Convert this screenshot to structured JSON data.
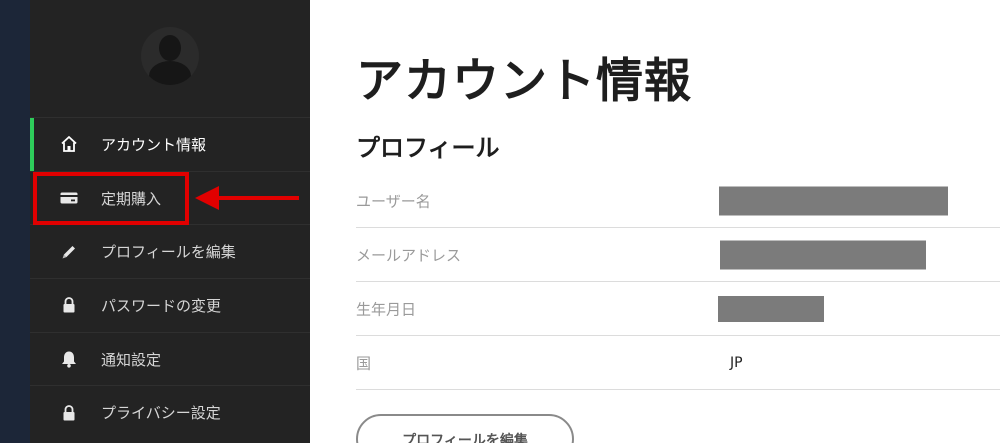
{
  "colors": {
    "sidebar_bg": "#232323",
    "left_strip": "#1c2638",
    "active_accent": "#2ecc5a",
    "highlight": "#e10000",
    "redaction": "#7b7b7b"
  },
  "sidebar": {
    "items": [
      {
        "label": "アカウント情報",
        "icon": "home-icon",
        "active": true
      },
      {
        "label": "定期購入",
        "icon": "credit-card-icon",
        "active": false
      },
      {
        "label": "プロフィールを編集",
        "icon": "pencil-icon",
        "active": false
      },
      {
        "label": "パスワードの変更",
        "icon": "lock-icon",
        "active": false
      },
      {
        "label": "通知設定",
        "icon": "bell-icon",
        "active": false
      },
      {
        "label": "プライバシー設定",
        "icon": "lock-icon",
        "active": false
      }
    ]
  },
  "main": {
    "title": "アカウント情報",
    "section_title": "プロフィール",
    "fields": [
      {
        "label": "ユーザー名",
        "value": "",
        "redacted": true
      },
      {
        "label": "メールアドレス",
        "value": "",
        "redacted": true
      },
      {
        "label": "生年月日",
        "value": "",
        "redacted": true
      },
      {
        "label": "国",
        "value": "JP",
        "redacted": false
      }
    ],
    "edit_button_label": "プロフィールを編集"
  }
}
